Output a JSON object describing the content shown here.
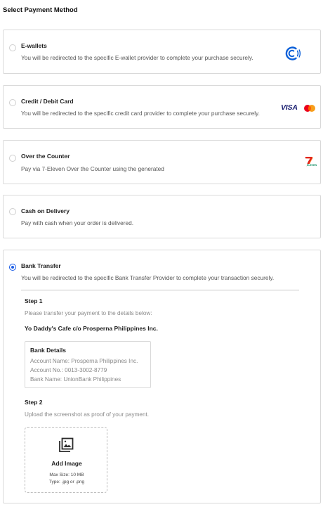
{
  "page": {
    "title": "Select Payment Method"
  },
  "options": [
    {
      "title": "E-wallets",
      "desc": "You will be redirected to the specific E-wallet provider to complete your purchase securely.",
      "selected": false,
      "logo": "gcash-icon"
    },
    {
      "title": "Credit / Debit Card",
      "desc": "You will be redirected to the specific credit card provider to complete your purchase securely.",
      "selected": false,
      "logo": "visa-mastercard-icon"
    },
    {
      "title": "Over the Counter",
      "desc": "Pay via 7-Eleven Over the Counter using the generated",
      "selected": false,
      "logo": "seven-eleven-icon"
    },
    {
      "title": "Cash on Delivery",
      "desc": "Pay with cash when your order is delivered.",
      "selected": false
    },
    {
      "title": "Bank Transfer",
      "desc": "You will be redirected to the specific Bank Transfer Provider to complete your transaction securely.",
      "selected": true
    }
  ],
  "logos": {
    "visa_text": "VISA",
    "seven_text": "7",
    "seven_sub": "ELEVEN"
  },
  "bank_transfer": {
    "step1_label": "Step 1",
    "step1_text": "Please transfer your payment to the details below:",
    "merchant": "Yo Daddy's Cafe c/o Prosperna Philippines Inc.",
    "bank_details": {
      "title": "Bank Details",
      "account_name": "Account Name: Prosperna Philippines Inc.",
      "account_no": "Account No.: 0013-3002-8779",
      "bank_name": "Bank Name: UnionBank Philippines"
    },
    "step2_label": "Step 2",
    "step2_text": "Upload the screenshot as proof of your payment.",
    "upload": {
      "title": "Add Image",
      "max_size": "Max Size: 10 MB",
      "types": "Type: .jpg or .png",
      "icon": "image-upload-icon"
    }
  },
  "colors": {
    "accent": "#1a5ce6",
    "border": "#d9d9d9",
    "gcash": "#0a5fd8",
    "visa": "#1a1f71",
    "mc_red": "#eb001b",
    "mc_yellow": "#f79e1b",
    "seven_orange": "#f26f21",
    "seven_green": "#00875a",
    "seven_red": "#e2231a"
  }
}
